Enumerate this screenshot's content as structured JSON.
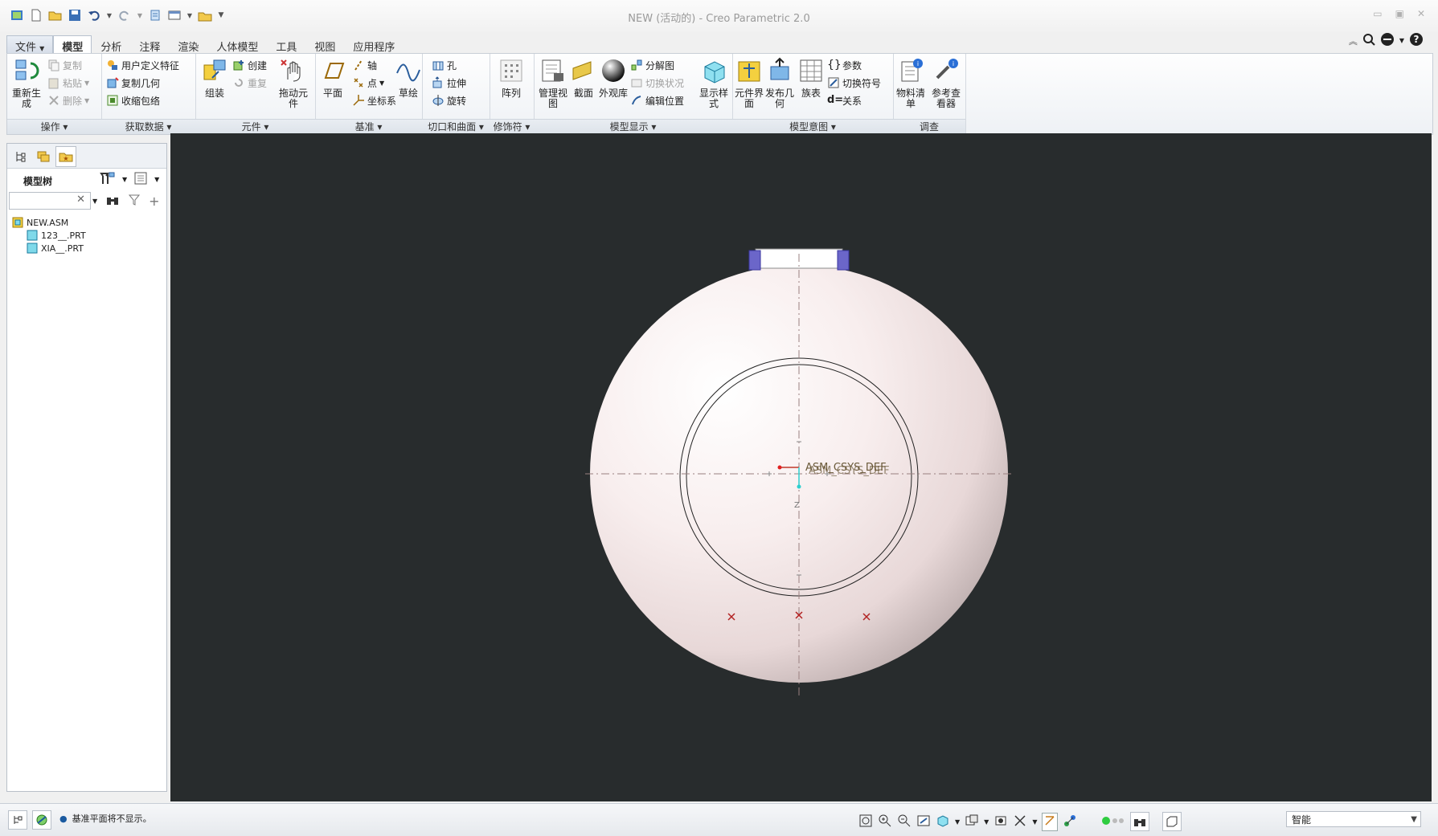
{
  "window": {
    "title": "NEW (活动的) - Creo Parametric 2.0"
  },
  "menu_tabs": [
    {
      "label": "文件",
      "active": false
    },
    {
      "label": "模型",
      "active": true
    },
    {
      "label": "分析",
      "active": false
    },
    {
      "label": "注释",
      "active": false
    },
    {
      "label": "渲染",
      "active": false
    },
    {
      "label": "人体模型",
      "active": false
    },
    {
      "label": "工具",
      "active": false
    },
    {
      "label": "视图",
      "active": false
    },
    {
      "label": "应用程序",
      "active": false
    }
  ],
  "ribbon": {
    "groups": {
      "operations": "操作",
      "get_data": "获取数据",
      "component": "元件",
      "datum": "基准",
      "cut_surface": "切口和曲面",
      "modifiers": "修饰符",
      "model_display": "模型显示",
      "model_intent": "模型意图",
      "investigate": "调查"
    },
    "operations": {
      "regenerate": "重新生成",
      "copy": "复制",
      "paste": "粘贴",
      "delete": "删除"
    },
    "get_data": {
      "udf": "用户定义特征",
      "copy_geom": "复制几何",
      "shrinkwrap": "收缩包络"
    },
    "component": {
      "assemble": "组装",
      "create": "创建",
      "repeat": "重复",
      "drag": "拖动元件"
    },
    "datum": {
      "plane": "平面",
      "axis": "轴",
      "point": "点",
      "csys": "坐标系",
      "sketch": "草绘"
    },
    "cut_surface": {
      "hole": "孔",
      "extrude": "拉伸",
      "revolve": "旋转"
    },
    "modifiers": {
      "pattern": "阵列"
    },
    "model_display": {
      "manage_views": "管理视图",
      "section": "截面",
      "appearance": "外观库",
      "explode": "分解图",
      "toggle_status": "切换状况",
      "edit_position": "编辑位置",
      "display_style": "显示样式"
    },
    "model_intent": {
      "component_interface": "元件界面",
      "publish_geom": "发布几何",
      "family_table": "族表",
      "parameters": "参数",
      "switch_symbols": "切换符号",
      "relations": "关系"
    },
    "investigate": {
      "bom": "物料清单",
      "ref_viewer": "参考查看器"
    }
  },
  "model_tree": {
    "title": "模型树",
    "search_placeholder": "",
    "items": [
      {
        "label": "NEW.ASM",
        "level": 0
      },
      {
        "label": "123__.PRT",
        "level": 1
      },
      {
        "label": "XIA__.PRT",
        "level": 1
      }
    ]
  },
  "viewport": {
    "csys_label": "ASM_CSYS_DEF",
    "axis_label": "Z",
    "background": "#282c2d",
    "model_color": "#f4e6e6"
  },
  "status": {
    "message": "基准平面将不显示。",
    "filter_value": "智能"
  }
}
